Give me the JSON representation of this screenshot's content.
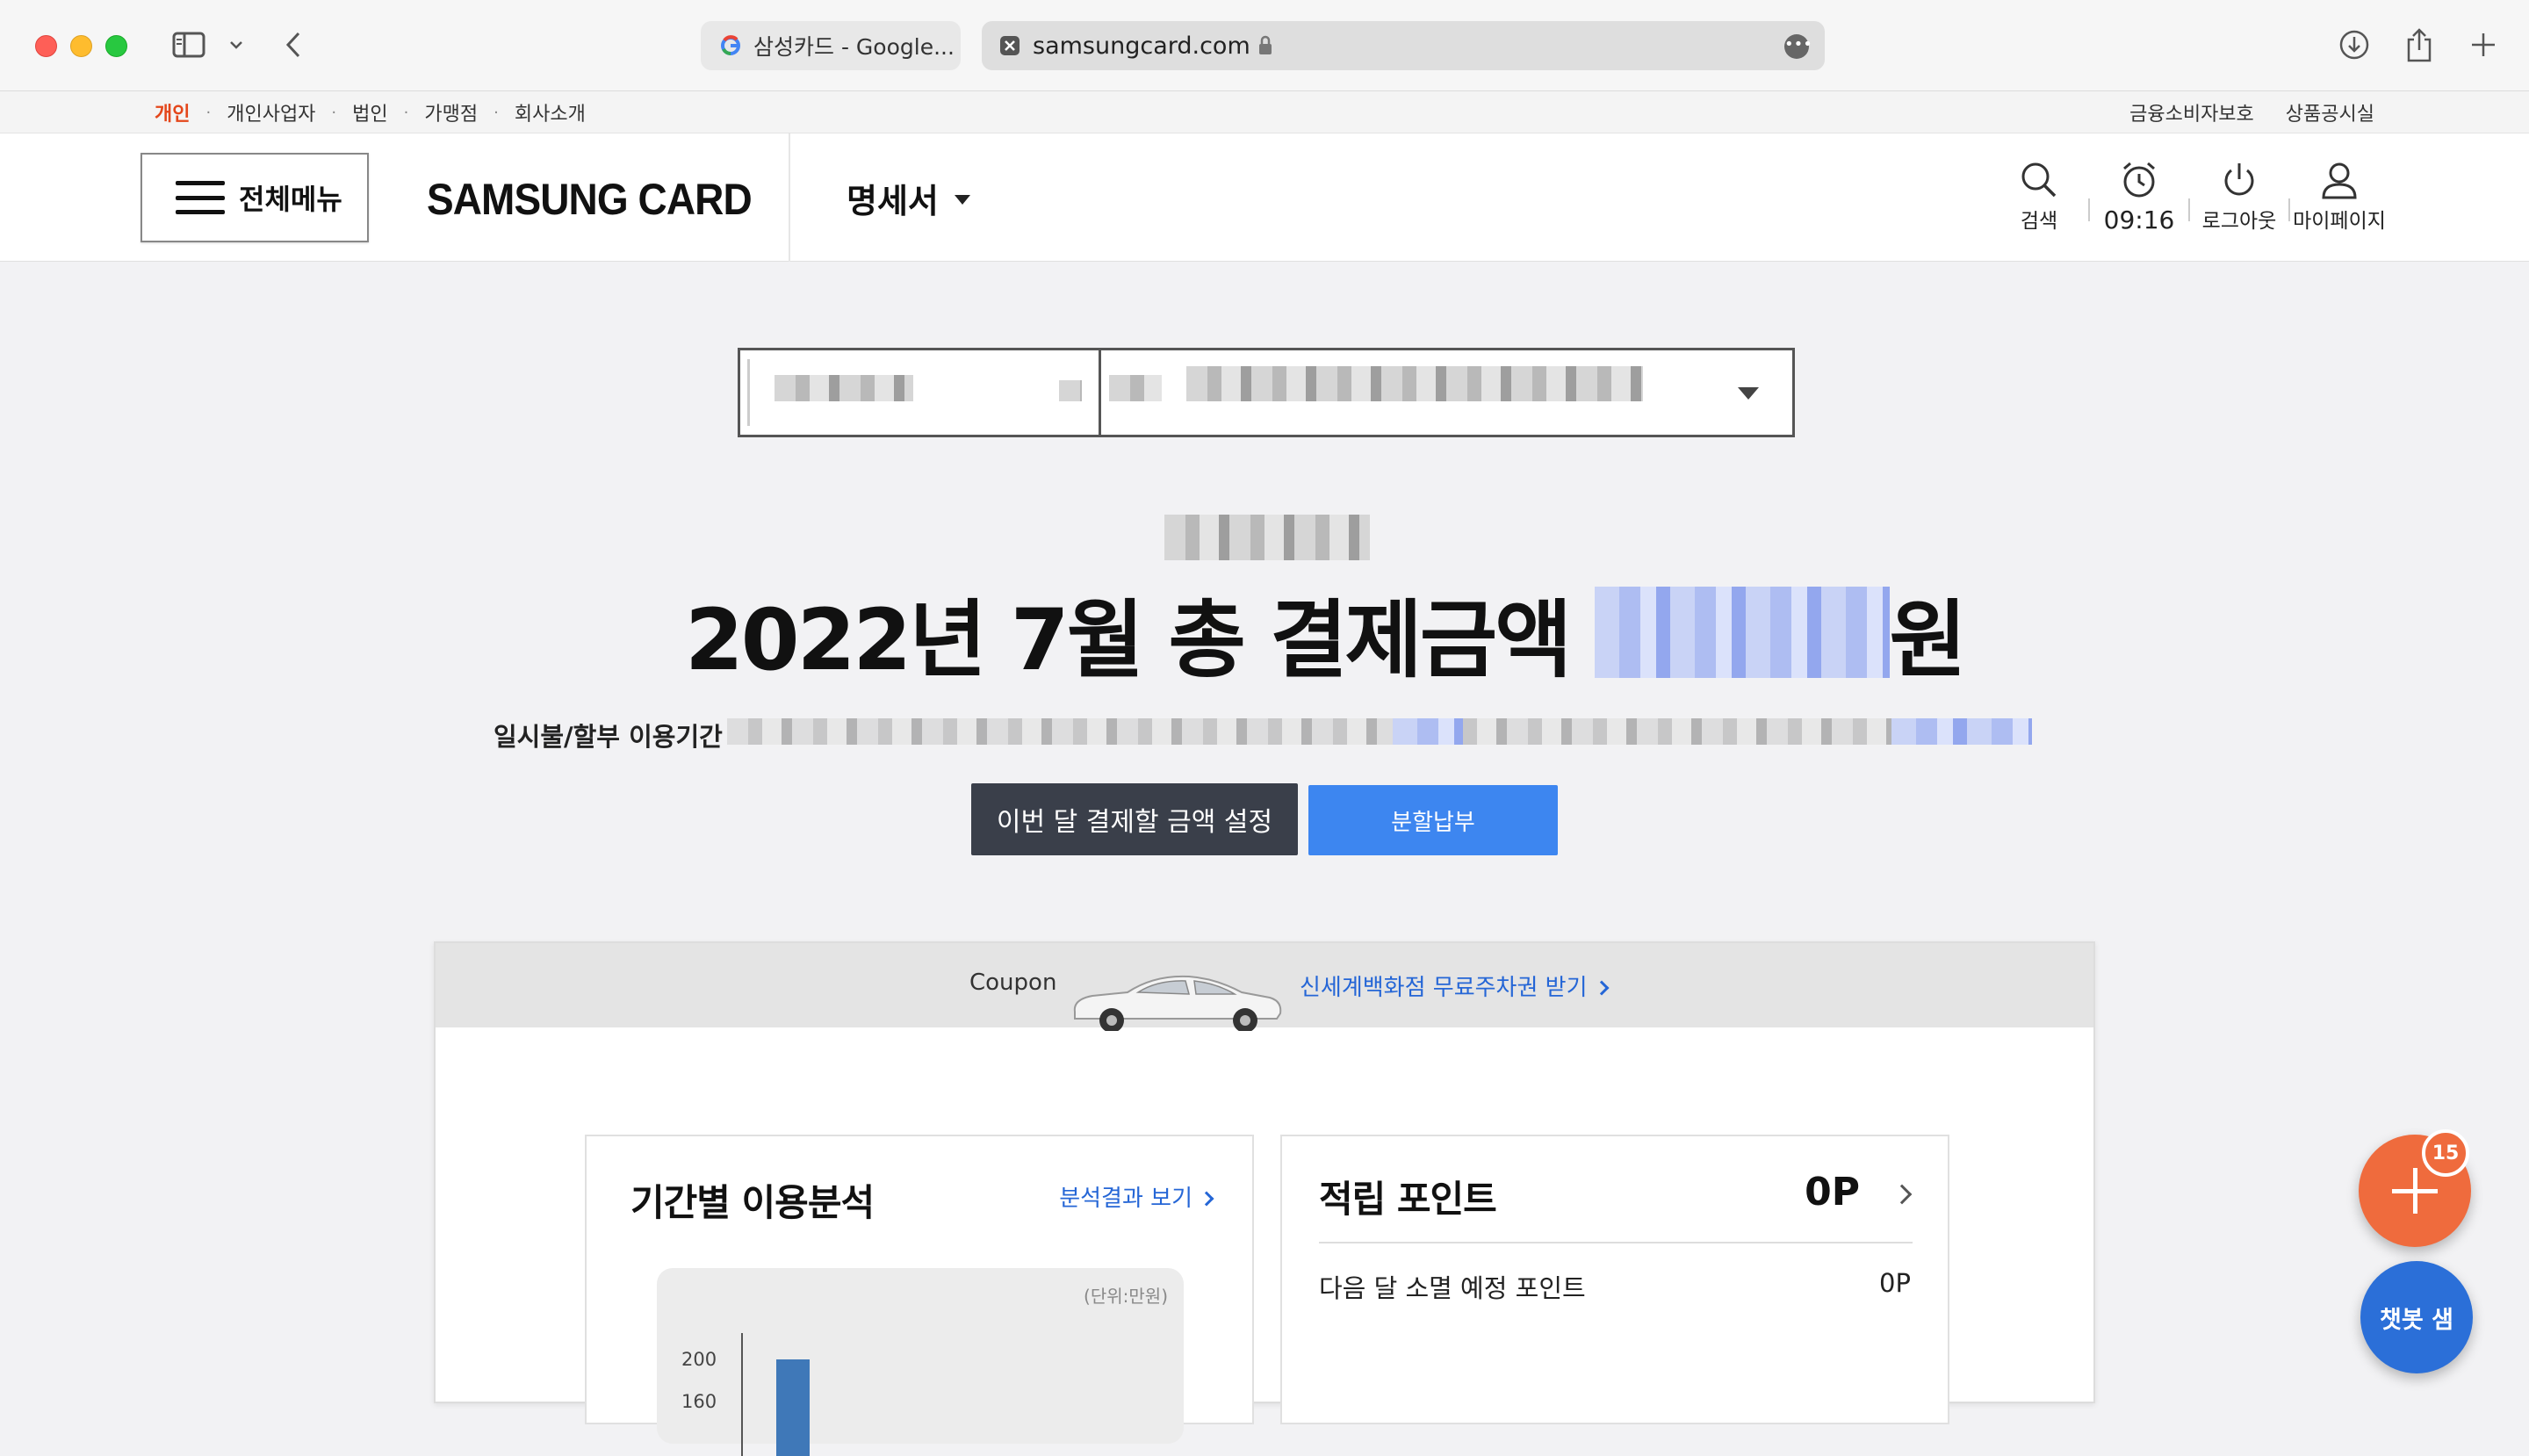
{
  "browser": {
    "tabs": [
      {
        "label": "삼성카드 - Google..."
      },
      {
        "label": "samsungcard.com"
      }
    ]
  },
  "utility_nav": {
    "left": [
      "개인",
      "개인사업자",
      "법인",
      "가맹점",
      "회사소개"
    ],
    "right": [
      "금융소비자보호",
      "상품공시실"
    ]
  },
  "header": {
    "menu_label": "전체메뉴",
    "logo": "SAMSUNG CARD",
    "section": "명세서",
    "icons": {
      "search": "검색",
      "timer": "09:16",
      "logout": "로그아웃",
      "mypage": "마이페이지"
    }
  },
  "statement": {
    "total_prefix": "2022년 7월 총 결제금액",
    "total_suffix": "원",
    "period_label": "일시불/할부 이용기간",
    "btn_set_amount": "이번 달 결제할 금액 설정",
    "btn_installment": "분할납부"
  },
  "coupon": {
    "label": "Coupon",
    "link": "신세계백화점 무료주차권 받기"
  },
  "analysis": {
    "title": "기간별 이용분석",
    "link": "분석결과 보기",
    "unit": "(단위:만원)",
    "ticks": [
      "200",
      "160"
    ]
  },
  "points": {
    "title": "적립 포인트",
    "value": "0P",
    "expiring_label": "다음 달 소멸 예정 포인트",
    "expiring_value": "0P"
  },
  "fab": {
    "badge": "15",
    "chat_label": "챗봇 샘"
  }
}
